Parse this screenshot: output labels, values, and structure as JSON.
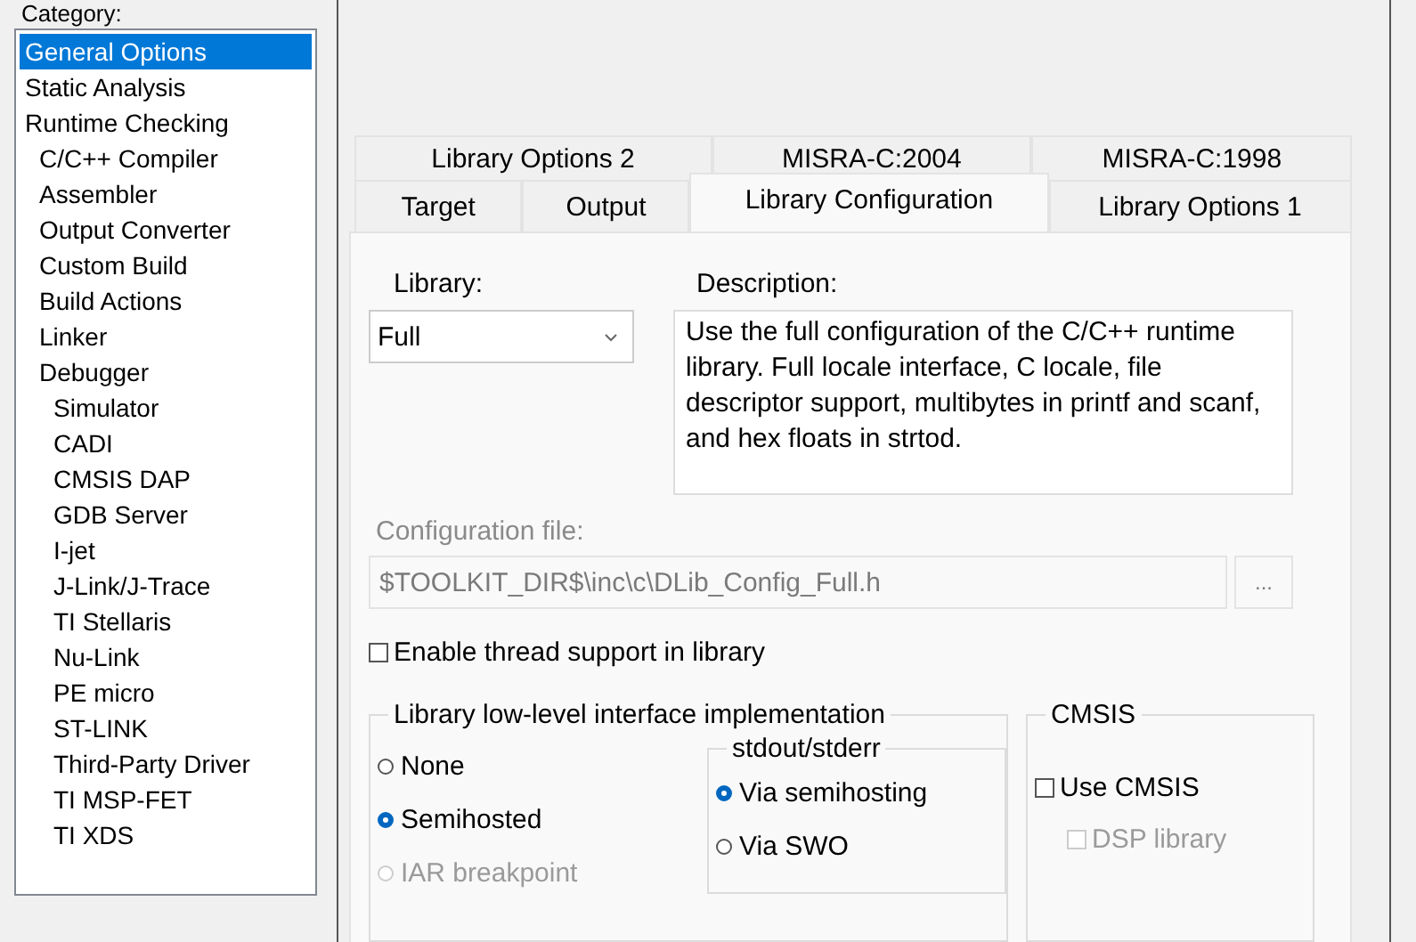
{
  "category": {
    "label": "Category:",
    "items": [
      {
        "label": "General Options",
        "selected": true
      },
      {
        "label": "Static Analysis",
        "selected": false
      },
      {
        "label": "Runtime Checking",
        "selected": false,
        "children": [
          {
            "label": "C/C++ Compiler",
            "selected": false
          },
          {
            "label": "Assembler",
            "selected": false
          },
          {
            "label": "Output Converter",
            "selected": false
          },
          {
            "label": "Custom Build",
            "selected": false
          },
          {
            "label": "Build Actions",
            "selected": false
          },
          {
            "label": "Linker",
            "selected": false
          },
          {
            "label": "Debugger",
            "selected": false,
            "children": [
              {
                "label": "Simulator",
                "selected": false
              },
              {
                "label": "CADI",
                "selected": false
              },
              {
                "label": "CMSIS DAP",
                "selected": false
              },
              {
                "label": "GDB Server",
                "selected": false
              },
              {
                "label": "I-jet",
                "selected": false
              },
              {
                "label": "J-Link/J-Trace",
                "selected": false
              },
              {
                "label": "TI Stellaris",
                "selected": false
              },
              {
                "label": "Nu-Link",
                "selected": false
              },
              {
                "label": "PE micro",
                "selected": false
              },
              {
                "label": "ST-LINK",
                "selected": false
              },
              {
                "label": "Third-Party Driver",
                "selected": false
              },
              {
                "label": "TI MSP-FET",
                "selected": false
              },
              {
                "label": "TI XDS",
                "selected": false
              }
            ]
          }
        ]
      }
    ]
  },
  "tab_rows": [
    [
      {
        "label": "Library Options 2",
        "selected": false
      },
      {
        "label": "MISRA-C:2004",
        "selected": false
      },
      {
        "label": "MISRA-C:1998",
        "selected": false
      }
    ],
    [
      {
        "label": "Target",
        "selected": false
      },
      {
        "label": "Output",
        "selected": false
      },
      {
        "label": "Library Configuration",
        "selected": true
      },
      {
        "label": "Library Options 1",
        "selected": false
      }
    ]
  ],
  "library": {
    "label": "Library:",
    "value": "Full"
  },
  "description": {
    "label": "Description:",
    "text": "Use the full configuration of the C/C++ runtime library. Full locale interface, C locale, file descriptor support, multibytes in printf and scanf, and hex floats in strtod."
  },
  "config_file": {
    "label": "Configuration file:",
    "value": "$TOOLKIT_DIR$\\inc\\c\\DLib_Config_Full.h",
    "button": "...",
    "disabled": true
  },
  "thread_support": {
    "label": "Enable thread support in library",
    "checked": false
  },
  "low_level": {
    "title": "Library low-level interface implementation",
    "options": [
      {
        "label": "None",
        "selected": false,
        "disabled": false
      },
      {
        "label": "Semihosted",
        "selected": true,
        "disabled": false
      },
      {
        "label": "IAR breakpoint",
        "selected": false,
        "disabled": true
      }
    ],
    "stdout": {
      "title": "stdout/stderr",
      "options": [
        {
          "label": "Via semihosting",
          "selected": true,
          "disabled": false
        },
        {
          "label": "Via SWO",
          "selected": false,
          "disabled": false
        }
      ]
    }
  },
  "cmsis": {
    "title": "CMSIS",
    "options": [
      {
        "label": "Use CMSIS",
        "checked": false,
        "disabled": false
      },
      {
        "label": "DSP library",
        "checked": false,
        "disabled": true
      }
    ]
  }
}
